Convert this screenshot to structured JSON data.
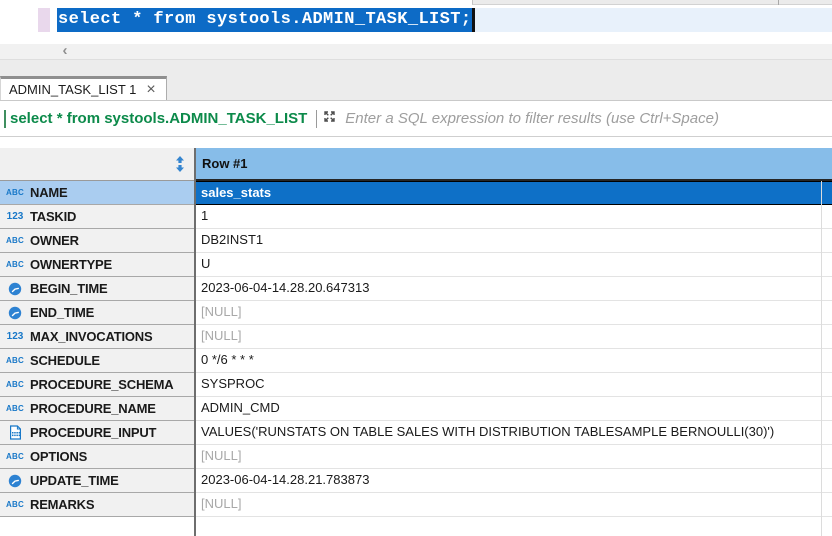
{
  "editor": {
    "sql_line": "select * from systools.ADMIN_TASK_LIST;"
  },
  "scrollbar": {
    "left_arrow_glyph": "‹"
  },
  "results_tab": {
    "label": "ADMIN_TASK_LIST 1",
    "close_glyph": "×"
  },
  "filter_bar": {
    "expression": "select * from systools.ADMIN_TASK_LIST",
    "placeholder": "Enter a SQL expression to filter results (use Ctrl+Space)"
  },
  "grid": {
    "column_header": "Row #1",
    "rows": [
      {
        "label": "NAME",
        "type": "string",
        "value": "sales_stats",
        "selected": true
      },
      {
        "label": "TASKID",
        "type": "integer",
        "value": "1"
      },
      {
        "label": "OWNER",
        "type": "string",
        "value": "DB2INST1"
      },
      {
        "label": "OWNERTYPE",
        "type": "string",
        "value": "U"
      },
      {
        "label": "BEGIN_TIME",
        "type": "timestamp",
        "value": "2023-06-04-14.28.20.647313"
      },
      {
        "label": "END_TIME",
        "type": "timestamp",
        "value": "[NULL]",
        "is_null": true
      },
      {
        "label": "MAX_INVOCATIONS",
        "type": "integer",
        "value": "[NULL]",
        "is_null": true
      },
      {
        "label": "SCHEDULE",
        "type": "string",
        "value": "0 */6 * * *"
      },
      {
        "label": "PROCEDURE_SCHEMA",
        "type": "string",
        "value": "SYSPROC"
      },
      {
        "label": "PROCEDURE_NAME",
        "type": "string",
        "value": "ADMIN_CMD"
      },
      {
        "label": "PROCEDURE_INPUT",
        "type": "document",
        "value": "VALUES('RUNSTATS ON TABLE SALES WITH DISTRIBUTION TABLESAMPLE BERNOULLI(30)')"
      },
      {
        "label": "OPTIONS",
        "type": "string",
        "value": "[NULL]",
        "is_null": true
      },
      {
        "label": "UPDATE_TIME",
        "type": "timestamp",
        "value": "2023-06-04-14.28.21.783873"
      },
      {
        "label": "REMARKS",
        "type": "string",
        "value": "[NULL]",
        "is_null": true
      }
    ]
  },
  "icons": {
    "string_type": "ABC",
    "integer_type": "123"
  },
  "colors": {
    "editor_selection": "#0d6bc6",
    "editor_line_highlight": "#e8f1fb",
    "column_header_blue": "#87bde9",
    "selected_row_header": "#aacdf0",
    "selected_cell": "#0e70c7",
    "filter_text_green": "#0c8a4a",
    "type_icon_blue": "#1878c8",
    "null_text": "#a8a8a8"
  }
}
